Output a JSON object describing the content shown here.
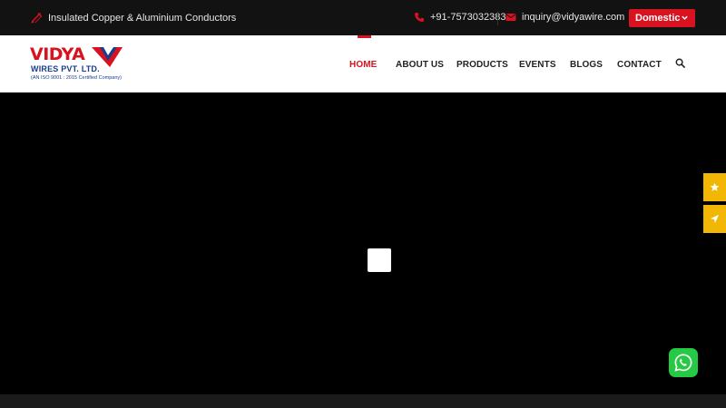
{
  "topbar": {
    "tagline": "Insulated Copper & Aluminium Conductors",
    "phone": "+91-7573032383",
    "email": "inquiry@vidyawire.com",
    "market_select": "Domestic"
  },
  "logo": {
    "name": "VIDYA",
    "subtitle": "WIRES PVT. LTD.",
    "certification": "(AN ISO 9001 : 2015 Certified Company)"
  },
  "nav": {
    "items": [
      {
        "label": "HOME",
        "active": true
      },
      {
        "label": "ABOUT US",
        "active": false
      },
      {
        "label": "PRODUCTS",
        "active": false
      },
      {
        "label": "EVENTS",
        "active": false
      },
      {
        "label": "BLOGS",
        "active": false
      },
      {
        "label": "CONTACT",
        "active": false
      }
    ]
  },
  "icons": {
    "tagline": "pen-check-icon",
    "phone": "phone-icon",
    "email": "envelope-icon",
    "market_chevron": "chevron-down-icon",
    "search": "search-icon",
    "side_1": "star-icon",
    "side_2": "location-arrow-icon",
    "whatsapp": "whatsapp-icon"
  },
  "colors": {
    "accent": "#d9121f",
    "brand_blue": "#1a3d8f",
    "side_buttons": "#f2b705",
    "whatsapp": "#26c943"
  }
}
